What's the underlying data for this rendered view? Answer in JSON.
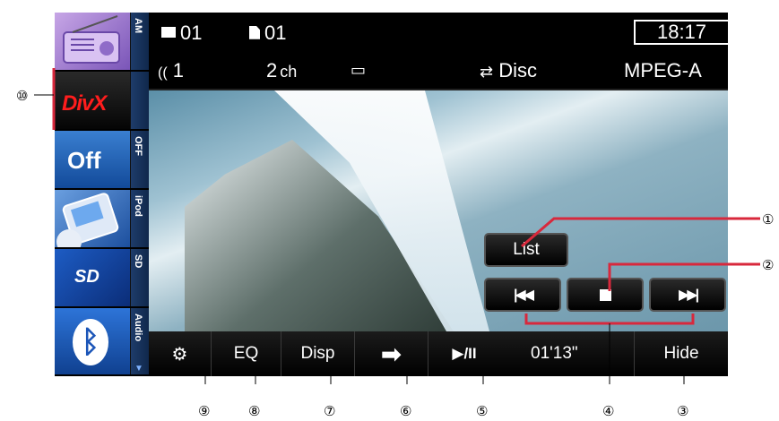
{
  "page": {
    "heading": ""
  },
  "source_bar": {
    "items": [
      {
        "tag": "AM",
        "icon": "radio-icon"
      },
      {
        "tag": "",
        "label": "DivX",
        "icon": "divx-logo"
      },
      {
        "tag": "OFF",
        "label": "Off"
      },
      {
        "tag": "iPod",
        "icon": "ipod-icon"
      },
      {
        "tag": "SD",
        "label": "SD",
        "icon": "sd-card-icon"
      },
      {
        "tag": "Audio",
        "icon": "bluetooth-icon",
        "glyph": "ᛒ"
      }
    ],
    "scroll_glyph": "▼"
  },
  "status": {
    "folder": "01",
    "file": "01",
    "audio_track": "1",
    "audio_glyph": "((",
    "channels": "2",
    "channels_unit": "ch",
    "subtitle_glyph": "▭",
    "repeat_glyph": "⇄",
    "repeat_label": "Disc",
    "format": "MPEG-A",
    "clock": "18:17"
  },
  "video_controls": {
    "list_label": "List",
    "prev_glyph": "|◀◀",
    "next_glyph": "▶▶|"
  },
  "bottom_bar": {
    "settings_glyph": "⚙",
    "eq_label": "EQ",
    "disp_label": "Disp",
    "repeat_glyph": "➡",
    "play_pause_glyph": "▶/II",
    "elapsed_time": "01'13\"",
    "hide_label": "Hide"
  },
  "callouts": [
    "①",
    "②",
    "③",
    "④",
    "⑤",
    "⑥",
    "⑦",
    "⑧",
    "⑨",
    "⑩"
  ],
  "colors": {
    "screen_bg": "#000000",
    "divx_red": "#ff1d1d",
    "source_blue": "#1b55b8",
    "tag_bg": "#1e3c6a"
  }
}
